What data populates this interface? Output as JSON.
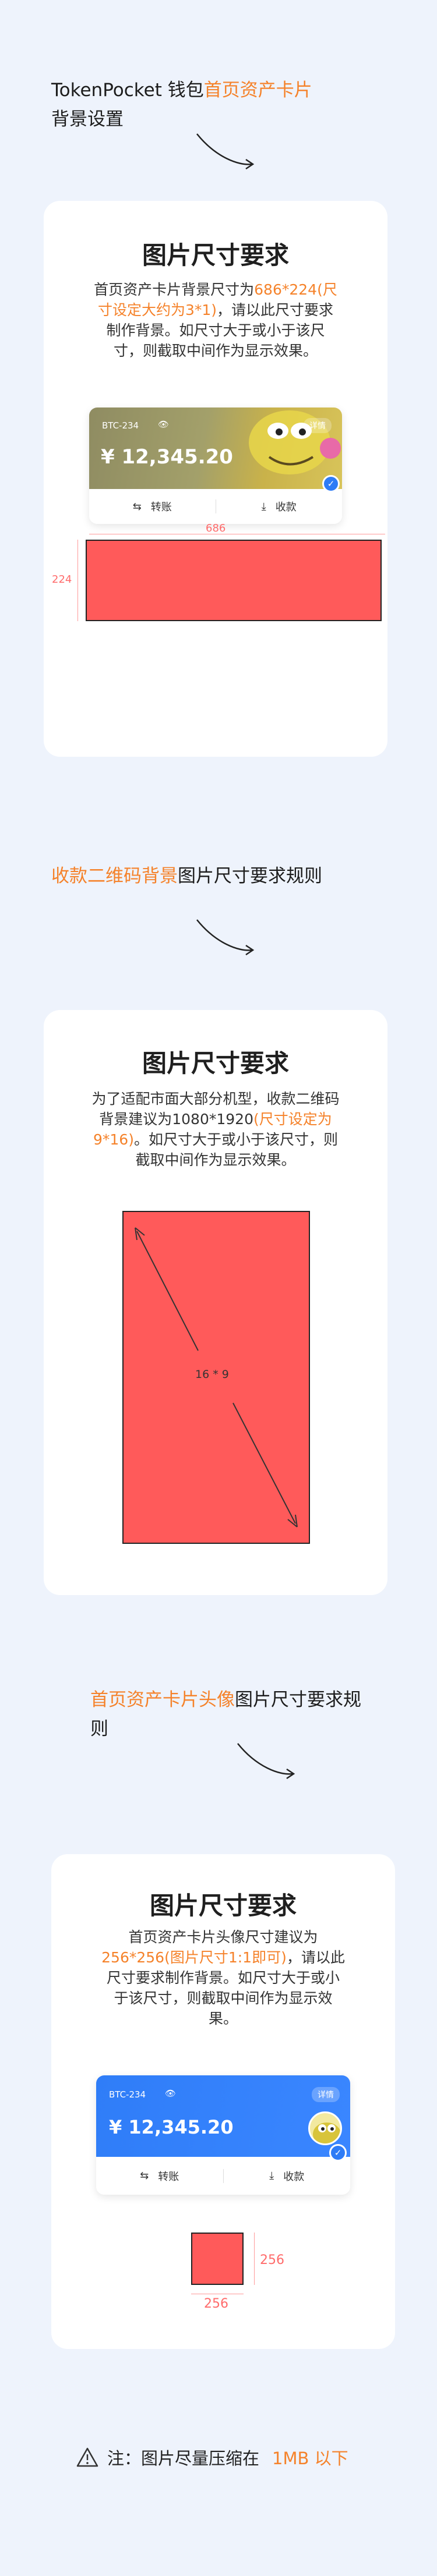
{
  "section1": {
    "heading_pre": "TokenPocket 钱包",
    "heading_hl": "首页资产卡片",
    "heading_post": "背景设置",
    "card_title": "图片尺寸要求",
    "desc_pre": "首页资产卡片背景尺寸为",
    "desc_hl": "686*224(尺寸设定大约为3*1)",
    "desc_post": "，请以此尺寸要求制作背景。如尺寸大于或小于该尺寸，则截取中间作为显示效果。",
    "wallet": {
      "ticker": "BTC-234",
      "balance": "¥ 12,345.20",
      "detail": "详情",
      "transfer": "转账",
      "receive": "收款"
    },
    "width_label": "686",
    "height_label": "224"
  },
  "section2": {
    "heading_hl": "收款二维码背景",
    "heading_post": "图片尺寸要求规则",
    "card_title": "图片尺寸要求",
    "desc_pre": "为了适配市面大部分机型，收款二维码背景建议为1080*1920",
    "desc_hl": "(尺寸设定为9*16)",
    "desc_post": "。如尺寸大于或小于该尺寸，则截取中间作为显示效果。",
    "ratio_label": "16 * 9"
  },
  "section3": {
    "heading_hl": "首页资产卡片头像",
    "heading_post": "图片尺寸要求规则",
    "card_title": "图片尺寸要求",
    "desc_pre": "首页资产卡片头像尺寸建议为",
    "desc_hl": "256*256(图片尺寸1:1即可)",
    "desc_post": "，请以此尺寸要求制作背景。如尺寸大于或小于该尺寸，则截取中间作为显示效果。",
    "wallet": {
      "ticker": "BTC-234",
      "balance": "¥ 12,345.20",
      "detail": "详情",
      "transfer": "转账",
      "receive": "收款"
    },
    "width_label": "256",
    "height_label": "256"
  },
  "note": {
    "pre": "注：图片尽量压缩在",
    "hl": "1MB 以下"
  },
  "colors": {
    "accent": "#f5822a",
    "placeholder": "#ff5a5a",
    "brand_blue": "#2e7cf6",
    "background": "#eef3fc"
  }
}
